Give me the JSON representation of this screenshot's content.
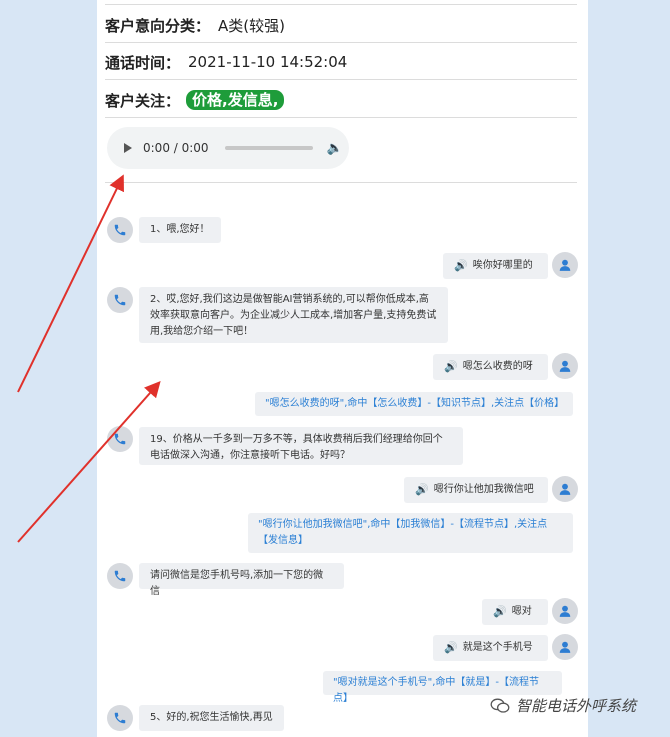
{
  "info": {
    "intent_label": "客户意向分类：",
    "intent_value": "A类(较强)",
    "time_label": "通话时间：",
    "time_value": "2021-11-10 14:52:04",
    "focus_label": "客户关注：",
    "focus_value": "价格,发信息,"
  },
  "audio": {
    "time": "0:00 / 0:00"
  },
  "messages": {
    "m1": "1、喂,您好！",
    "m2": "唉你好哪里的",
    "m3": "2、哎,您好,我们这边是做智能AI营销系统的,可以帮你低成本,高效率获取意向客户。为企业减少人工成本,增加客户量,支持免费试用,我给您介绍一下吧！",
    "m4": "嗯怎么收费的呀",
    "h1": "\"嗯怎么收费的呀\",命中【怎么收费】-【知识节点】,关注点【价格】",
    "m5": "19、价格从一千多到一万多不等，具体收费稍后我们经理给你回个电话做深入沟通，你注意接听下电话。好吗？",
    "m6": "嗯行你让他加我微信吧",
    "h2": "\"嗯行你让他加我微信吧\",命中【加我微信】-【流程节点】,关注点【发信息】",
    "m7": "请问微信是您手机号吗,添加一下您的微信",
    "m8": "嗯对",
    "m9": "就是这个手机号",
    "h3": "\"嗯对就是这个手机号\",命中【就是】-【流程节点】",
    "m10": "5、好的,祝您生活愉快,再见"
  },
  "watermark": "智能电话外呼系统",
  "colors": {
    "tag_green": "#1e9c3a",
    "hit_blue": "#2a7fd4",
    "arrow_red": "#e0312b",
    "avatar_blue": "#2d7dd2"
  }
}
